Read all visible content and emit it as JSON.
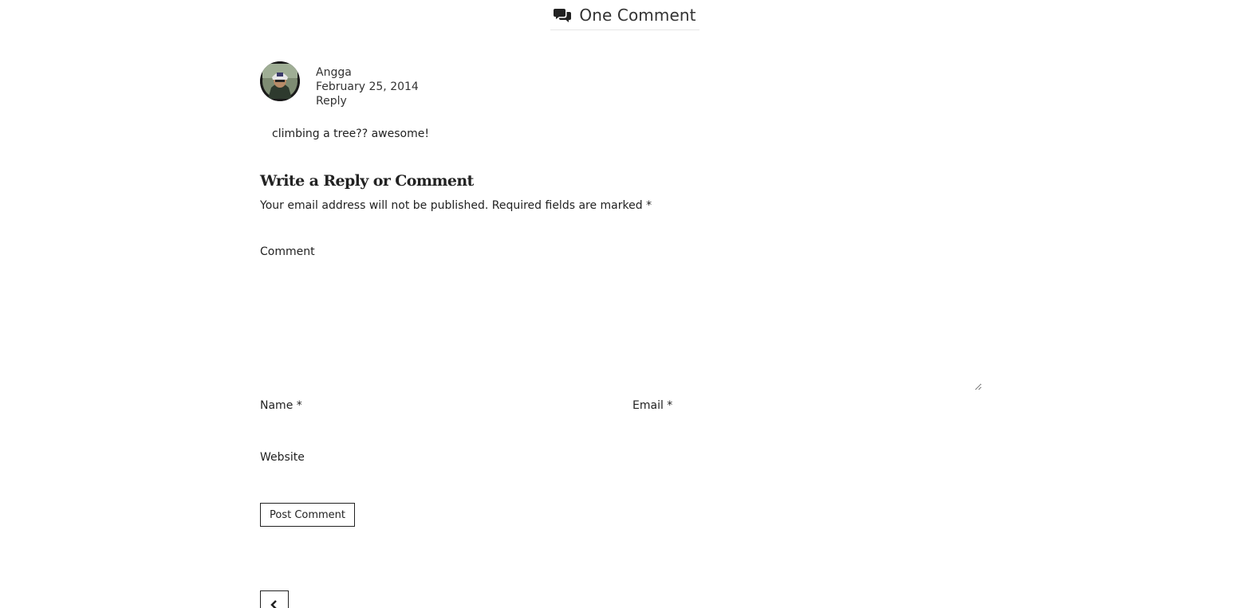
{
  "comments_header": {
    "icon": "comments-icon",
    "title": "One Comment"
  },
  "comment": {
    "avatar": "avatar",
    "author": "Angga",
    "date": "February 25, 2014",
    "reply_label": "Reply",
    "text": "climbing a tree?? awesome!"
  },
  "reply_form": {
    "title": "Write a Reply or Comment",
    "notes": "Your email address will not be published. Required fields are marked *",
    "comment_label": "Comment",
    "name_label": "Name *",
    "email_label": "Email *",
    "website_label": "Website",
    "submit_label": "Post Comment"
  },
  "navigation": {
    "prev_icon": "chevron-left-icon"
  }
}
